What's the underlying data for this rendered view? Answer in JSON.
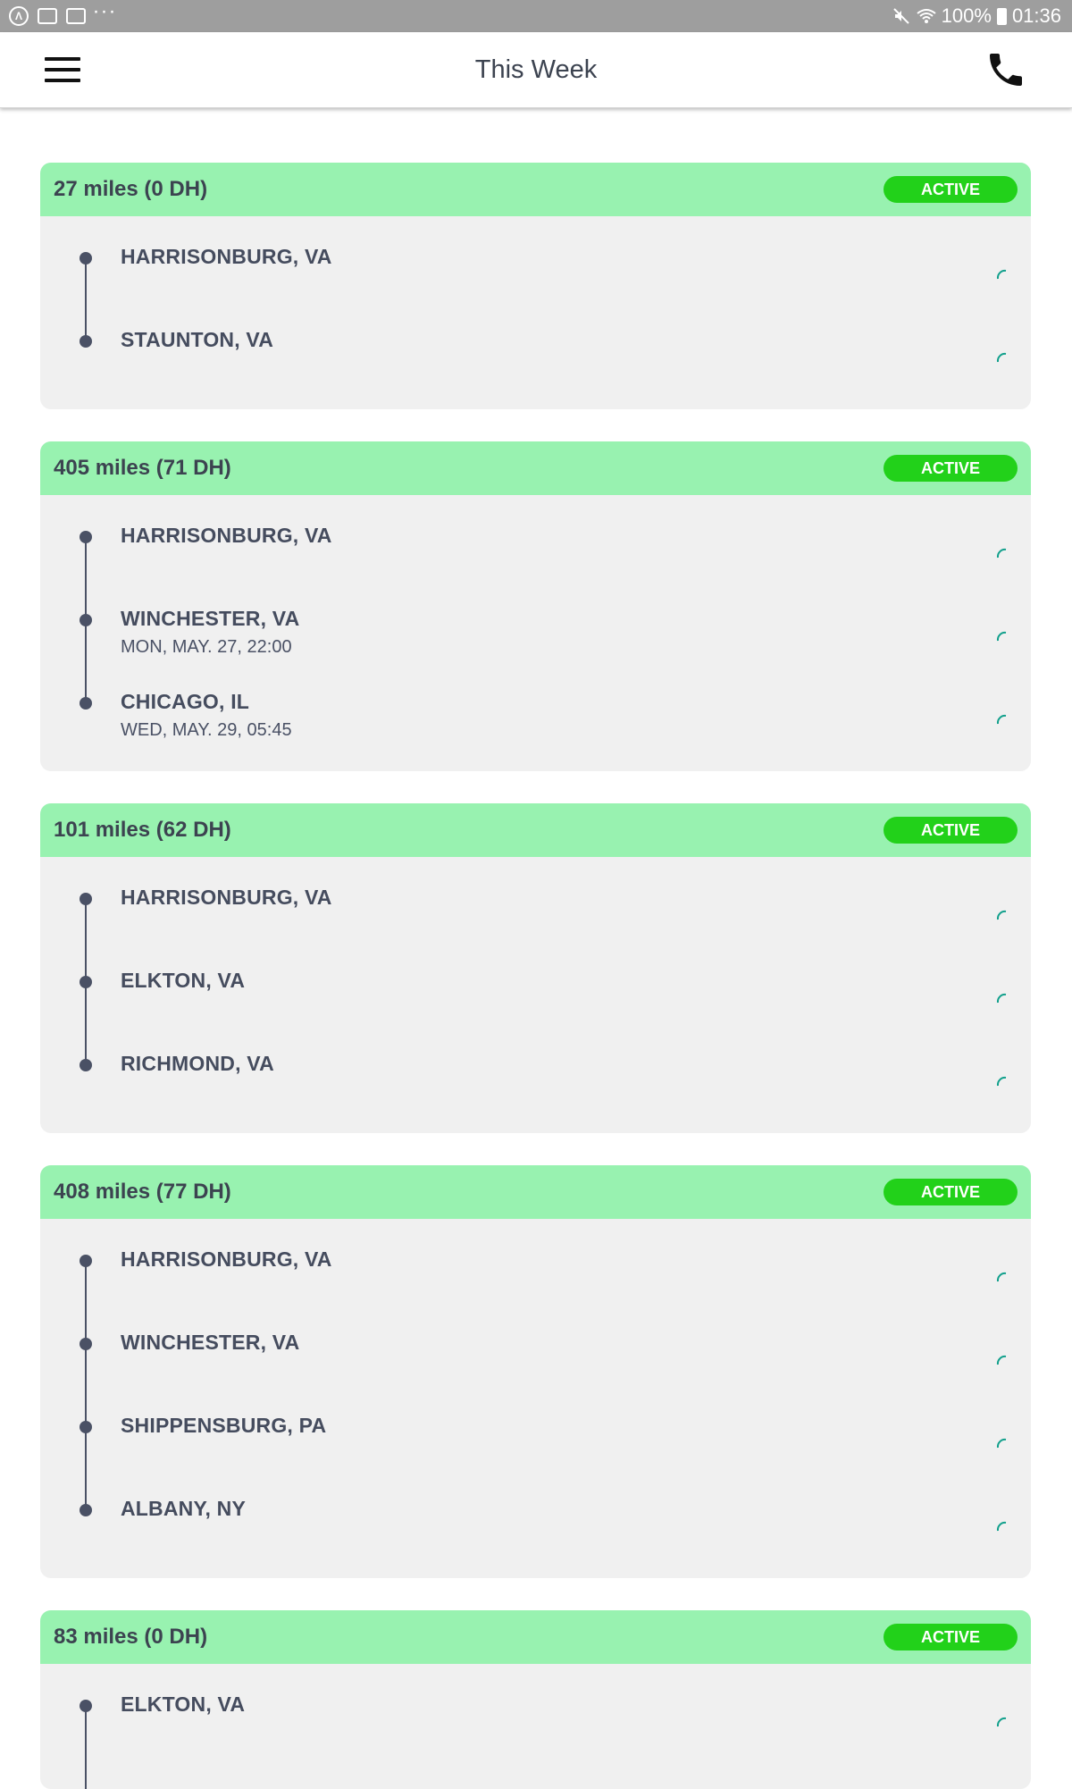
{
  "status_bar": {
    "battery": "100%",
    "time": "01:36",
    "icons": [
      "app-icon",
      "image-icon",
      "mail-icon",
      "more-dots-icon",
      "mute-icon",
      "wifi-icon",
      "battery-icon"
    ]
  },
  "header": {
    "title": "This Week",
    "menu_icon": "hamburger-icon",
    "phone_icon": "phone-icon"
  },
  "colors": {
    "card_header": "#98f2b0",
    "badge": "#22d11a",
    "card_bg": "#f0f0f0",
    "timeline": "#4a5165",
    "spinner": "#12a08c"
  },
  "loads": [
    {
      "miles": "27 miles (0 DH)",
      "status": "ACTIVE",
      "stops": [
        {
          "city": "HARRISONBURG, VA",
          "time": ""
        },
        {
          "city": "STAUNTON, VA",
          "time": ""
        }
      ]
    },
    {
      "miles": "405 miles (71 DH)",
      "status": "ACTIVE",
      "stops": [
        {
          "city": "HARRISONBURG, VA",
          "time": ""
        },
        {
          "city": "WINCHESTER, VA",
          "time": "MON, MAY. 27, 22:00"
        },
        {
          "city": "CHICAGO, IL",
          "time": "WED, MAY. 29, 05:45"
        }
      ]
    },
    {
      "miles": "101 miles (62 DH)",
      "status": "ACTIVE",
      "stops": [
        {
          "city": "HARRISONBURG, VA",
          "time": ""
        },
        {
          "city": "ELKTON, VA",
          "time": ""
        },
        {
          "city": "RICHMOND, VA",
          "time": ""
        }
      ]
    },
    {
      "miles": "408 miles (77 DH)",
      "status": "ACTIVE",
      "stops": [
        {
          "city": "HARRISONBURG, VA",
          "time": ""
        },
        {
          "city": "WINCHESTER, VA",
          "time": ""
        },
        {
          "city": "SHIPPENSBURG, PA",
          "time": ""
        },
        {
          "city": "ALBANY, NY",
          "time": ""
        }
      ]
    },
    {
      "miles": "83 miles (0 DH)",
      "status": "ACTIVE",
      "stops": [
        {
          "city": "ELKTON, VA",
          "time": ""
        }
      ]
    }
  ]
}
